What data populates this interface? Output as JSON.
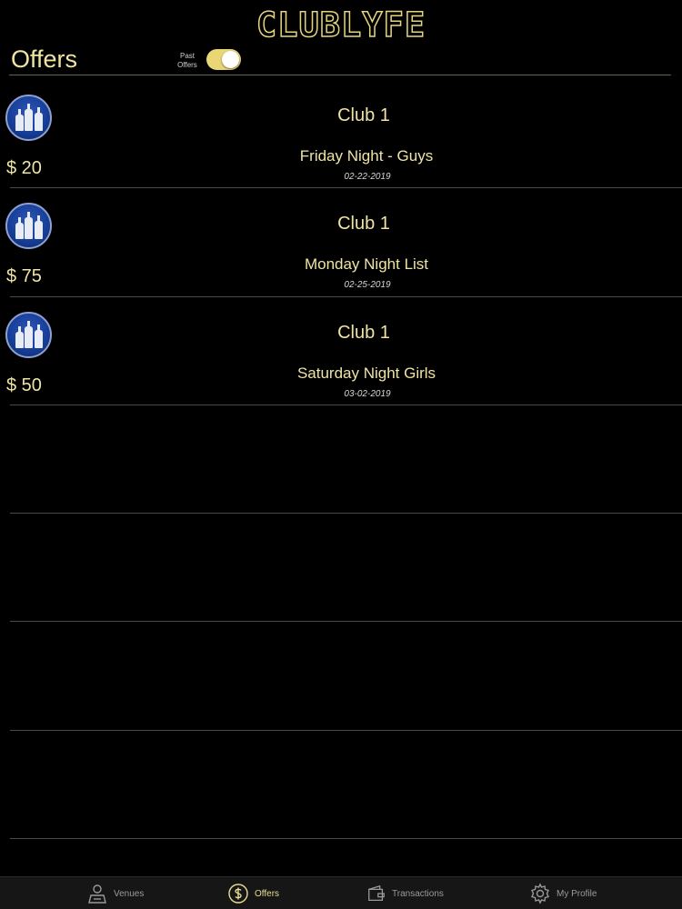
{
  "app": {
    "logo": "CLUBLYFE"
  },
  "header": {
    "title": "Offers",
    "toggle_label": "Past Offers",
    "toggle_on": true
  },
  "offers": [
    {
      "venue": "Club 1",
      "name": "Friday Night - Guys",
      "date": "02-22-2019",
      "price": "$ 20"
    },
    {
      "venue": "Club 1",
      "name": "Monday Night List",
      "date": "02-25-2019",
      "price": "$ 75"
    },
    {
      "venue": "Club 1",
      "name": "Saturday Night Girls",
      "date": "03-02-2019",
      "price": "$ 50"
    }
  ],
  "tabbar": {
    "items": [
      {
        "label": "Venues",
        "icon": "venues-icon",
        "active": false
      },
      {
        "label": "Offers",
        "icon": "dollar-icon",
        "active": true
      },
      {
        "label": "Transactions",
        "icon": "wallet-icon",
        "active": false
      },
      {
        "label": "My Profile",
        "icon": "gear-icon",
        "active": false
      }
    ]
  },
  "colors": {
    "background": "#000000",
    "accent": "#e8dc94",
    "toggle": "#e9d776"
  }
}
